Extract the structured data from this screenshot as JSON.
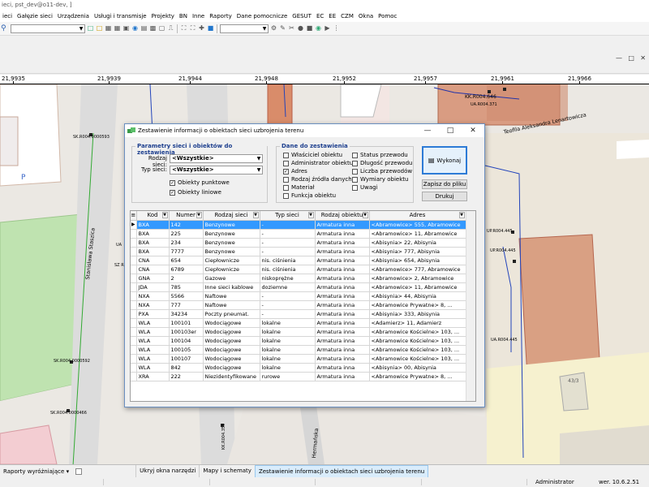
{
  "window": {
    "title": "ieci, pst_dev@o11-dev, ]",
    "menu": [
      "ieci",
      "Gałęzie sieci",
      "Urządzenia",
      "Usługi i transmisje",
      "Projekty",
      "BN",
      "Inne",
      "Raporty",
      "Dane pomocnicze",
      "GESUT",
      "EC",
      "EE",
      "CZM",
      "Okna",
      "Pomoc"
    ]
  },
  "ruler": [
    "21,9935",
    "21,9939",
    "21,9944",
    "21,9948",
    "21,9952",
    "21,9957",
    "21,9961",
    "21,9966"
  ],
  "map_labels": {
    "kk": "KK.R004.646",
    "ua371": "UA.R004.371",
    "street1": "Teofila Aleksandra Lenartowicza",
    "sk593": "SK.R004.0000593",
    "p": "P",
    "street2": "Stanisława Staszica",
    "street3": "Hermańska",
    "ua445": "UA.R004.445",
    "sk592": "SK.R004.0000592",
    "sk466": "SK.R004.0000466",
    "kr": "KK.R004.359",
    "ua": "UA",
    "sz": "SZ R",
    "up1": "UP.R004.445",
    "up2": "UP.R004.445",
    "num": "43/3"
  },
  "dialog": {
    "title": "Zestawienie informacji o obiektach sieci uzbrojenia terenu",
    "params_title": "Parametry sieci i obiektów do zestawienia",
    "rodzaj_label": "Rodzaj sieci:",
    "rodzaj_value": "<Wszystkie>",
    "typ_label": "Typ sieci:",
    "typ_value": "<Wszystkie>",
    "obiekty_punktowe": "Obiekty punktowe",
    "obiekty_liniowe": "Obiekty liniowe",
    "dane_title": "Dane do zestawienia",
    "dane_left": [
      {
        "label": "Właściciel obiektu",
        "checked": false
      },
      {
        "label": "Administrator obiektu",
        "checked": false
      },
      {
        "label": "Adres",
        "checked": true
      },
      {
        "label": "Rodzaj źródła danych",
        "checked": false
      },
      {
        "label": "Materiał",
        "checked": false
      },
      {
        "label": "Funkcja obiektu",
        "checked": false
      }
    ],
    "dane_right": [
      {
        "label": "Status przewodu",
        "checked": false
      },
      {
        "label": "Długość przewodu",
        "checked": false
      },
      {
        "label": "Liczba przewodów",
        "checked": false
      },
      {
        "label": "Wymiary obiektu",
        "checked": false
      },
      {
        "label": "Uwagi",
        "checked": false
      }
    ],
    "btn_wykonaj": "Wykonaj",
    "btn_zapisz": "Zapisz do pliku",
    "btn_drukuj": "Drukuj",
    "columns": [
      "Kod",
      "Numer",
      "Rodzaj sieci",
      "Typ sieci",
      "Rodzaj obiektu",
      "Adres"
    ],
    "rows": [
      [
        "BXA",
        "142",
        "Benzynowe",
        "-",
        "Armatura inna",
        "<Abramowice> 555, Abramowice"
      ],
      [
        "BXA",
        "225",
        "Benzynowe",
        "-",
        "Armatura inna",
        "<Abramowice> 11, Abramowice"
      ],
      [
        "BXA",
        "234",
        "Benzynowe",
        "-",
        "Armatura inna",
        "<Abisynia> 22, Abisynia"
      ],
      [
        "BXA",
        "7777",
        "Benzynowe",
        "-",
        "Armatura inna",
        "<Abisynia> 777, Abisynia"
      ],
      [
        "CNA",
        "654",
        "Ciepłownicze",
        "nis. ciśnienia",
        "Armatura inna",
        "<Abisynia> 654, Abisynia"
      ],
      [
        "CNA",
        "6789",
        "Ciepłownicze",
        "nis. ciśnienia",
        "Armatura inna",
        "<Abramowice> 777, Abramowice"
      ],
      [
        "GNA",
        "2",
        "Gazowe",
        "niskoprężne",
        "Armatura inna",
        "<Abramowice> 2, Abramowice"
      ],
      [
        "JDA",
        "785",
        "Inne sieci kablowe",
        "doziemne",
        "Armatura inna",
        "<Abramowice> 11, Abramowice"
      ],
      [
        "NXA",
        "5566",
        "Naftowe",
        "-",
        "Armatura inna",
        "<Abisynia> 44, Abisynia"
      ],
      [
        "NXA",
        "777",
        "Naftowe",
        "-",
        "Armatura inna",
        "<Abramowice Prywatne> 8, ..."
      ],
      [
        "PXA",
        "34234",
        "Poczty pneumat.",
        "-",
        "Armatura inna",
        "<Abisynia> 333, Abisynia"
      ],
      [
        "WLA",
        "100101",
        "Wodociągowe",
        "lokalne",
        "Armatura inna",
        "<Adamierz> 11, Adamierz"
      ],
      [
        "WLA",
        "100103er",
        "Wodociągowe",
        "lokalne",
        "Armatura inna",
        "<Abramowice Kościelne> 103, ..."
      ],
      [
        "WLA",
        "100104",
        "Wodociągowe",
        "lokalne",
        "Armatura inna",
        "<Abramowice Kościelne> 103, ..."
      ],
      [
        "WLA",
        "100105",
        "Wodociągowe",
        "lokalne",
        "Armatura inna",
        "<Abramowice Kościelne> 103, ..."
      ],
      [
        "WLA",
        "100107",
        "Wodociągowe",
        "lokalne",
        "Armatura inna",
        "<Abramowice Kościelne> 103, ..."
      ],
      [
        "WLA",
        "842",
        "Wodociągowe",
        "lokalne",
        "Armatura inna",
        "<Abisynia> 00, Abisynia"
      ],
      [
        "XRA",
        "222",
        "Niezidentyfikowane",
        "rurowe",
        "Armatura inna",
        "<Abramowice Prywatne> 8, ..."
      ]
    ],
    "selected_row": 0
  },
  "bottombar": {
    "raporty": "Raporty wyróżniające",
    "tabs": [
      "Ukryj okna narzędzi",
      "Mapy i schematy",
      "Zestawienie informacji o obiektach sieci uzbrojenia terenu"
    ],
    "active_tab": 2
  },
  "status": {
    "user": "Administrator",
    "version": "wer. 10.6.2.51"
  }
}
